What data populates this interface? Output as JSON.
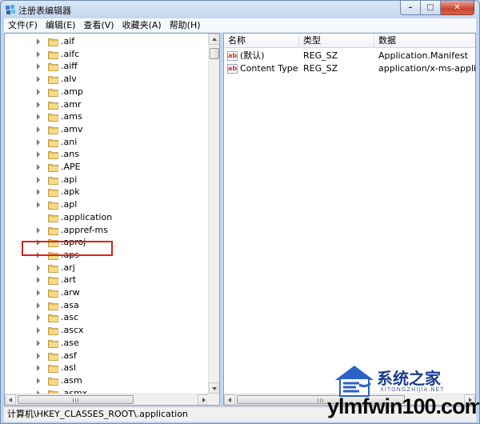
{
  "window": {
    "title": "注册表编辑器"
  },
  "caption": {
    "min": "–",
    "max": "□",
    "close": "✕"
  },
  "menu": [
    "文件(F)",
    "编辑(E)",
    "查看(V)",
    "收藏夹(A)",
    "帮助(H)"
  ],
  "tree": {
    "items": [
      ".aif",
      ".aifc",
      ".aiff",
      ".alv",
      ".amp",
      ".amr",
      ".ams",
      ".amv",
      ".ani",
      ".ans",
      ".APE",
      ".api",
      ".apk",
      ".apl",
      ".application",
      ".appref-ms",
      ".aproj",
      ".aps",
      ".arj",
      ".art",
      ".arw",
      ".asa",
      ".asc",
      ".ascx",
      ".ase",
      ".asf",
      ".asl",
      ".asm",
      ".asmx"
    ],
    "selected": ".application"
  },
  "values": {
    "columns": [
      "名称",
      "类型",
      "数据"
    ],
    "rows": [
      {
        "name": "(默认)",
        "type": "REG_SZ",
        "data": "Application.Manifest",
        "icon": "string-value-icon"
      },
      {
        "name": "Content Type",
        "type": "REG_SZ",
        "data": "application/x-ms-applicatio",
        "icon": "string-value-icon"
      }
    ]
  },
  "status": {
    "path": "计算机\\HKEY_CLASSES_ROOT\\.application"
  },
  "watermark": {
    "title": "系统之家",
    "subtitle": "XITONGZHIJIA.NET",
    "url": "ylmfwin100.com"
  },
  "colors": {
    "highlight_outline": "#e0201c",
    "folder": "#e8c35a"
  }
}
